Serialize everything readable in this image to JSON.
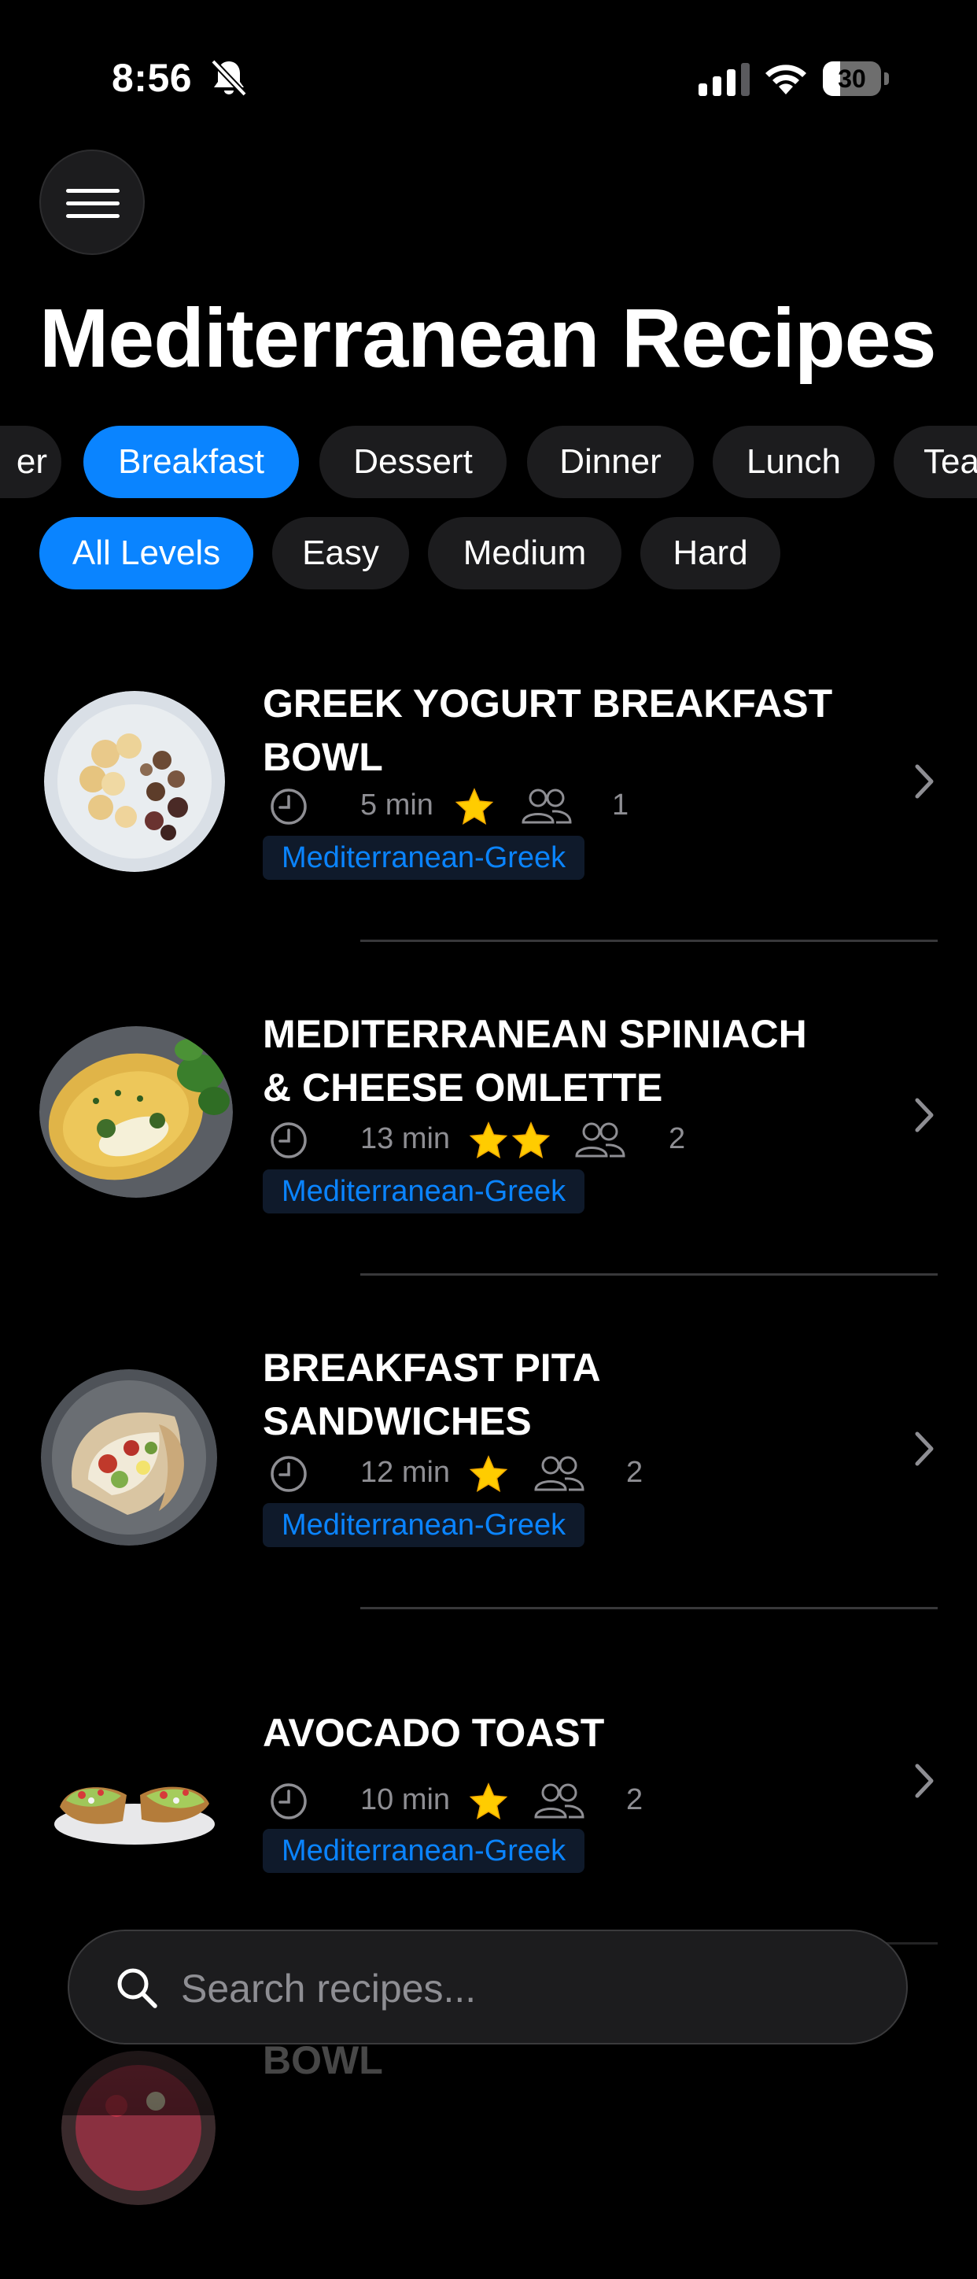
{
  "status_bar": {
    "time": "8:56",
    "battery_level": 30,
    "battery_text": "30",
    "icons": [
      "bell-slash-icon",
      "signal-icon",
      "wifi-icon",
      "battery-icon"
    ]
  },
  "header": {
    "menu_icon": "hamburger-menu-icon",
    "title": "Mediterranean Recipes"
  },
  "category_filters": [
    {
      "label": "Appetizer",
      "visible_text": "er",
      "active": false
    },
    {
      "label": "Breakfast",
      "active": true
    },
    {
      "label": "Dessert",
      "active": false
    },
    {
      "label": "Dinner",
      "active": false
    },
    {
      "label": "Lunch",
      "active": false
    },
    {
      "label": "Tea",
      "visible_text": "Tea",
      "active": false
    }
  ],
  "level_filters": [
    {
      "label": "All Levels",
      "active": true
    },
    {
      "label": "Easy",
      "active": false
    },
    {
      "label": "Medium",
      "active": false
    },
    {
      "label": "Hard",
      "active": false
    }
  ],
  "recipes": [
    {
      "title": "GREEK YOGURT BREAKFAST BOWL",
      "time": "5 min",
      "difficulty_stars": 1,
      "servings": "1",
      "cuisine": "Mediterranean-Greek"
    },
    {
      "title": "MEDITERRANEAN SPINIACH & CHEESE OMLETTE",
      "time": "13 min",
      "difficulty_stars": 2,
      "servings": "2",
      "cuisine": "Mediterranean-Greek"
    },
    {
      "title": "BREAKFAST PITA SANDWICHES",
      "time": "12 min",
      "difficulty_stars": 1,
      "servings": "2",
      "cuisine": "Mediterranean-Greek"
    },
    {
      "title": "AVOCADO TOAST",
      "time": "10 min",
      "difficulty_stars": 1,
      "servings": "2",
      "cuisine": "Mediterranean-Greek"
    },
    {
      "title": "STRAWBERRY SMOOTHIE BOWL"
    }
  ],
  "search": {
    "placeholder": "Search recipes..."
  },
  "colors": {
    "background": "#000000",
    "accent": "#0a84ff",
    "chip_background": "#1c1c1e",
    "secondary_text": "#8e8e93",
    "star": "#ffcc00"
  }
}
